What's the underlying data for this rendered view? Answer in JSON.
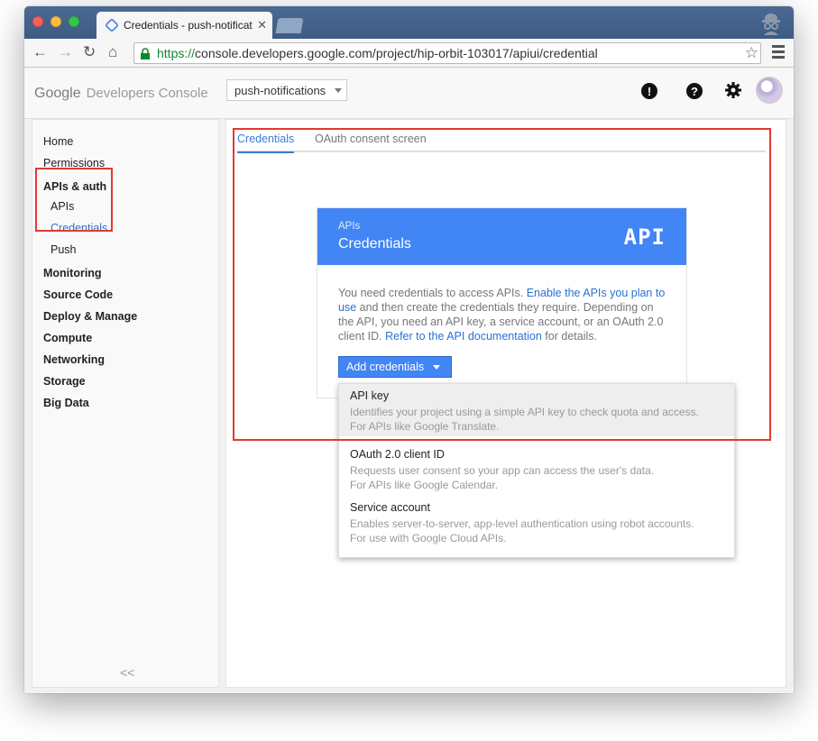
{
  "browser": {
    "tab_title": "Credentials - push-notificat",
    "url_protocol": "https://",
    "url_rest": "console.developers.google.com/project/hip-orbit-103017/apiui/credential"
  },
  "header": {
    "logo_google": "Google",
    "logo_product": "Developers Console",
    "project_name": "push-notifications"
  },
  "sidebar": {
    "items": [
      {
        "label": "Home"
      },
      {
        "label": "Permissions"
      },
      {
        "label": "APIs & auth"
      },
      {
        "label": "APIs"
      },
      {
        "label": "Credentials"
      },
      {
        "label": "Push"
      },
      {
        "label": "Monitoring"
      },
      {
        "label": "Source Code"
      },
      {
        "label": "Deploy & Manage"
      },
      {
        "label": "Compute"
      },
      {
        "label": "Networking"
      },
      {
        "label": "Storage"
      },
      {
        "label": "Big Data"
      }
    ],
    "collapse_label": "<<"
  },
  "main": {
    "tabs": [
      {
        "label": "Credentials"
      },
      {
        "label": "OAuth consent screen"
      }
    ],
    "card": {
      "kicker": "APIs",
      "title": "Credentials",
      "badge": "API",
      "text_1": "You need credentials to access APIs. ",
      "link_1": "Enable the APIs you plan to use",
      "text_2": " and then create the credentials they require. Depending on the API, you need an API key, a service account, or an OAuth 2.0 client ID. ",
      "link_2": "Refer to the API documentation",
      "text_3": " for details.",
      "button_label": "Add credentials"
    },
    "dropdown": [
      {
        "title": "API key",
        "line1": "Identifies your project using a simple API key to check quota and access.",
        "line2": "For APIs like Google Translate."
      },
      {
        "title": "OAuth 2.0 client ID",
        "line1": "Requests user consent so your app can access the user's data.",
        "line2": "For APIs like Google Calendar."
      },
      {
        "title": "Service account",
        "line1": "Enables server-to-server, app-level authentication using robot accounts.",
        "line2": "For use with Google Cloud APIs."
      }
    ]
  },
  "colors": {
    "accent_blue": "#4285f4",
    "link_blue": "#2a72d0",
    "annotation_red": "#e03a2f"
  }
}
